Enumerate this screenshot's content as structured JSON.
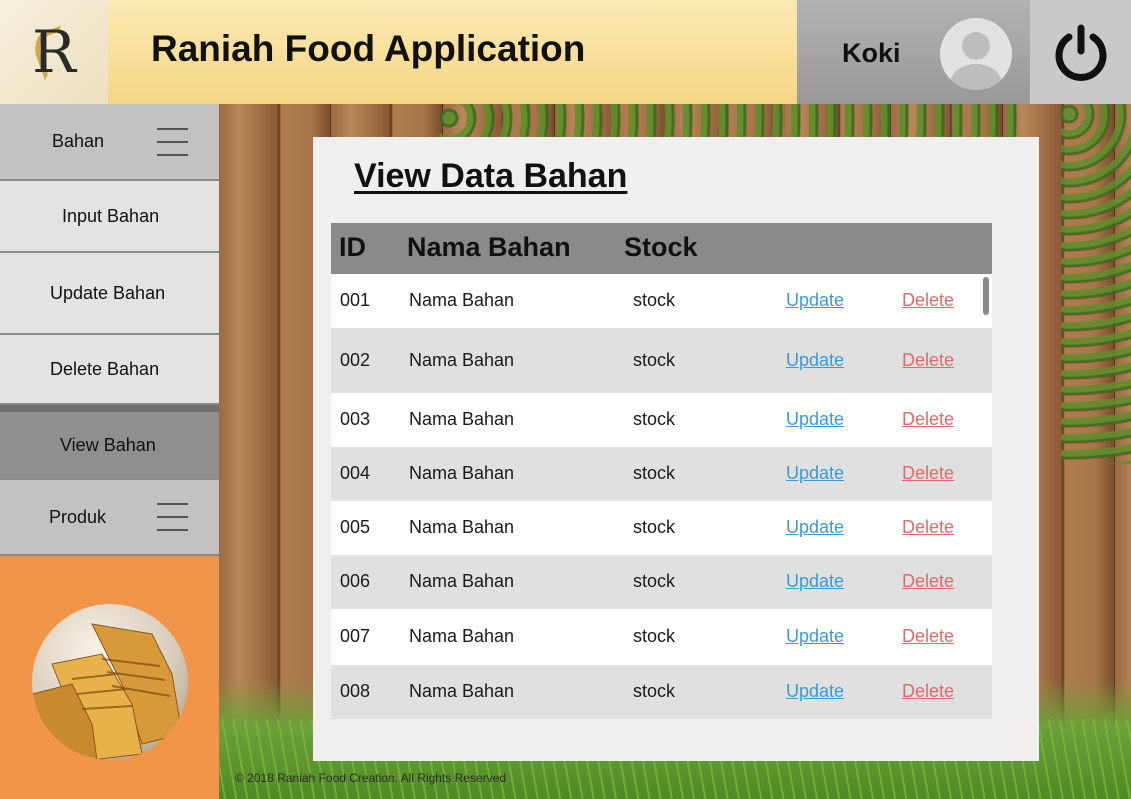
{
  "header": {
    "logo_letter": "R",
    "title": "Raniah Food Application",
    "user_name": "Koki"
  },
  "sidebar": {
    "items": [
      {
        "label": "Bahan",
        "type": "group"
      },
      {
        "label": "Input Bahan",
        "type": "sub"
      },
      {
        "label": "Update Bahan",
        "type": "sub"
      },
      {
        "label": "Delete Bahan",
        "type": "sub"
      },
      {
        "label": "View Bahan",
        "type": "active"
      },
      {
        "label": "Produk",
        "type": "group"
      }
    ]
  },
  "main": {
    "title": "View Data Bahan",
    "columns": [
      "ID",
      "Nama Bahan",
      "Stock"
    ],
    "rows": [
      {
        "id": "001",
        "nama": "Nama Bahan",
        "stock": "stock",
        "update": "Update",
        "delete": "Delete"
      },
      {
        "id": "002",
        "nama": "Nama Bahan",
        "stock": "stock",
        "update": "Update",
        "delete": "Delete"
      },
      {
        "id": "003",
        "nama": "Nama Bahan",
        "stock": "stock",
        "update": "Update",
        "delete": "Delete"
      },
      {
        "id": "004",
        "nama": "Nama Bahan",
        "stock": "stock",
        "update": "Update",
        "delete": "Delete"
      },
      {
        "id": "005",
        "nama": "Nama Bahan",
        "stock": "stock",
        "update": "Update",
        "delete": "Delete"
      },
      {
        "id": "006",
        "nama": "Nama Bahan",
        "stock": "stock",
        "update": "Update",
        "delete": "Delete"
      },
      {
        "id": "007",
        "nama": "Nama Bahan",
        "stock": "stock",
        "update": "Update",
        "delete": "Delete"
      },
      {
        "id": "008",
        "nama": "Nama Bahan",
        "stock": "stock",
        "update": "Update",
        "delete": "Delete"
      }
    ]
  },
  "footer": {
    "copyright": "© 2018 Raniah Food Creation. All Rights Reserved"
  },
  "colors": {
    "header_gold": "#f4d784",
    "sidebar_orange": "#f1954a",
    "table_header": "#8a8a8a",
    "update_link": "#3a9ad9",
    "delete_link": "#e06a6a"
  },
  "icons": [
    "logo-icon",
    "avatar-icon",
    "power-icon",
    "hamburger-icon"
  ]
}
